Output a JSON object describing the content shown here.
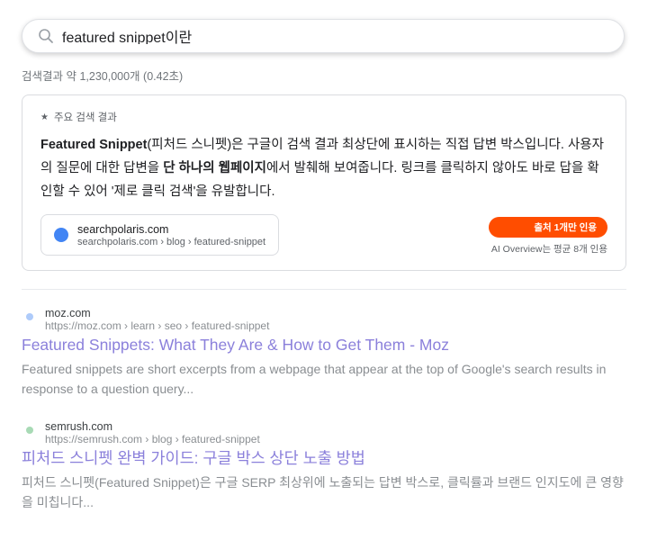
{
  "search": {
    "query": "featured snippet이란",
    "icon": "search-icon"
  },
  "stats": "검색결과 약 1,230,000개 (0.42초)",
  "featured_snippet": {
    "label": "주요 검색 결과",
    "label_icon": "star-icon",
    "text_parts": {
      "p1_bold": "Featured Snippet",
      "p2": "(피처드 스니펫)은 구글이 검색 결과 최상단에 표시하는 직접 답변 박스입니다. 사용자의 질문에 대한 답변을 ",
      "p3_bold": "단 하나의 웹페이지",
      "p4": "에서 발췌해 보여줍니다. 링크를 클릭하지 않아도 바로 답을 확인할 수 있어 '제로 클릭 검색'을 유발합니다."
    },
    "source": {
      "domain": "searchpolaris.com",
      "url": "searchpolaris.com › blog › featured-snippet",
      "favicon_color": "#4285f4"
    },
    "citation_badge": "출처 1개만 인용",
    "citation_badge_color": "#ff4d00",
    "citation_note": "AI Overview는 평균 8개 인용"
  },
  "results": [
    {
      "domain": "moz.com",
      "url": "https://moz.com › learn › seo › featured-snippet",
      "title": "Featured Snippets: What They Are & How to Get Them - Moz",
      "description": "Featured snippets are short excerpts from a webpage that appear at the top of Google's search results in response to a question query...",
      "favicon_color": "#aecbfa"
    },
    {
      "domain": "semrush.com",
      "url": "https://semrush.com › blog › featured-snippet",
      "title": "피처드 스니펫 완벽 가이드: 구글 박스 상단 노출 방법",
      "description": "피처드 스니펫(Featured Snippet)은 구글 SERP 최상위에 노출되는 답변 박스로, 클릭률과 브랜드 인지도에 큰 영향을 미칩니다...",
      "favicon_color": "#a8dab5"
    }
  ],
  "colors": {
    "result_title": "#8b80db",
    "muted_text": "#8a8e92"
  }
}
